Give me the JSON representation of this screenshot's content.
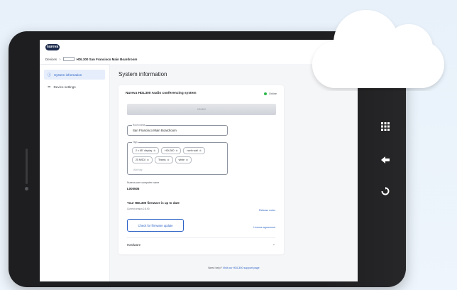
{
  "brand": {
    "logo_text": "nureva"
  },
  "breadcrumb": {
    "root": "Devices",
    "separator": ">",
    "current": "HDL300 San Francisco Main Boardroom"
  },
  "sidebar": {
    "items": [
      {
        "label": "System information",
        "icon": "info-icon",
        "active": true
      },
      {
        "label": "Device settings",
        "icon": "sliders-icon",
        "active": false
      }
    ]
  },
  "page": {
    "title": "System information"
  },
  "system": {
    "name": "Nureva HDL300 Audio conferencing system",
    "status": "Online",
    "status_color": "#2db84d",
    "device_image_label": "HDL300"
  },
  "room_name": {
    "label": "Room name",
    "value": "San Francisco Main Boardroom"
  },
  "tags": {
    "label": "Tags",
    "items": [
      "2 x 65\" display",
      "HDL300",
      "north wall",
      "25 MSDI",
      "Teams",
      "white"
    ],
    "placeholder": "Add tag"
  },
  "serial": {
    "label": "Nureva.com computer name",
    "value": "L000505"
  },
  "firmware": {
    "title": "Your HDL300 firmware is up to date",
    "sub": "Current version 2.8.90",
    "release_link": "Release notes",
    "check_button": "Check for firmware update",
    "license_link": "License agreement"
  },
  "hardware": {
    "label": "Hardware"
  },
  "help": {
    "prefix": "Need help?",
    "link": "Visit our HDL300 support page"
  },
  "accent": "#2b62c6"
}
